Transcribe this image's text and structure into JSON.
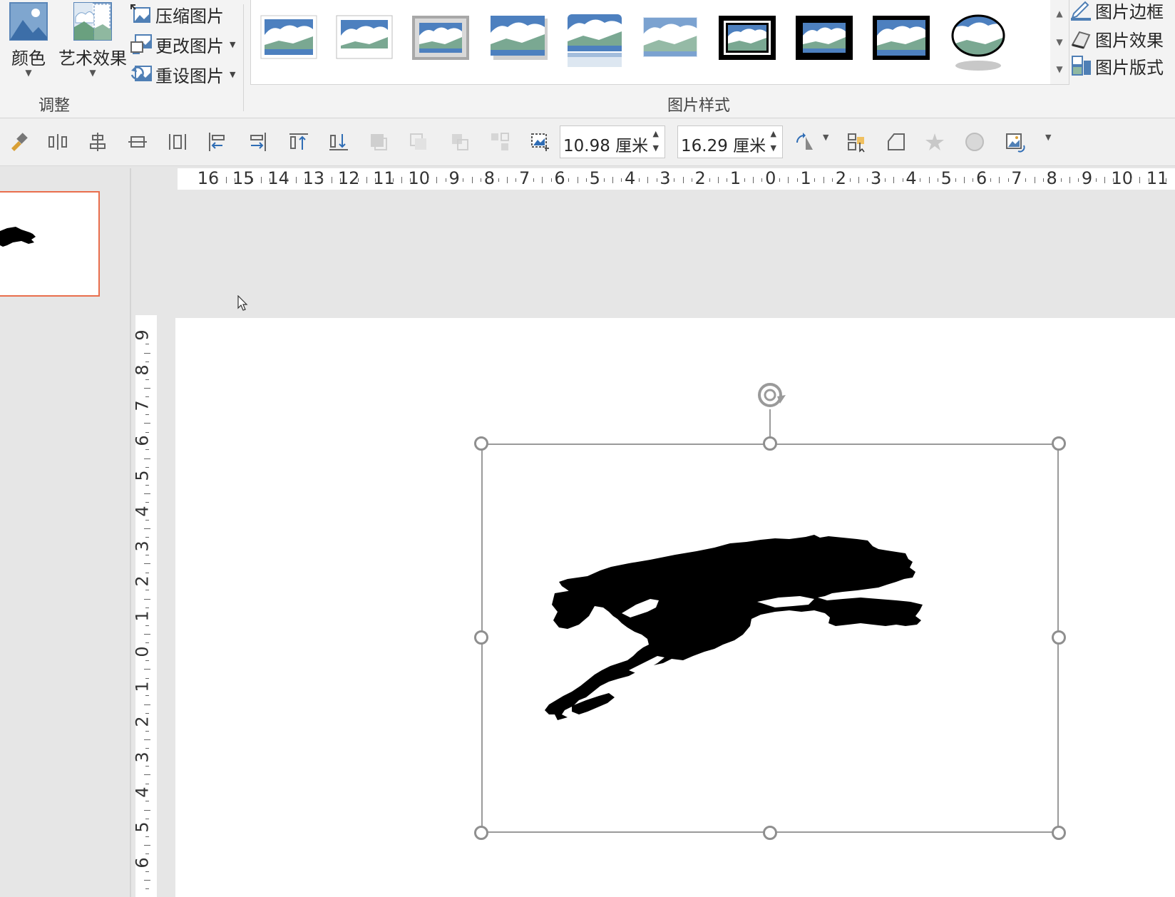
{
  "ribbon": {
    "adjust": {
      "color_label": "颜色",
      "artistic_label": "艺术效果",
      "compress_label": "压缩图片",
      "change_label": "更改图片",
      "reset_label": "重设图片",
      "group_label": "调整"
    },
    "styles_group_label": "图片样式",
    "right": {
      "border_label": "图片边框",
      "effects_label": "图片效果",
      "layout_label": "图片版式"
    }
  },
  "qat": {
    "height_value": "10.98 厘米",
    "width_value": "16.29 厘米"
  },
  "rulers": {
    "horizontal": [
      "16",
      "15",
      "14",
      "13",
      "12",
      "11",
      "10",
      "9",
      "8",
      "7",
      "6",
      "5",
      "4",
      "3",
      "2",
      "1",
      "0",
      "1",
      "2",
      "3",
      "4",
      "5",
      "6",
      "7",
      "8",
      "9",
      "10",
      "11"
    ],
    "vertical": [
      "9",
      "8",
      "7",
      "6",
      "5",
      "4",
      "3",
      "2",
      "1",
      "0",
      "1",
      "2",
      "3",
      "4",
      "5",
      "6"
    ]
  },
  "colors": {
    "thumbnail_border": "#e96e4c",
    "ribbon_bg": "#f3f3f3",
    "workspace_bg": "#e6e6e6"
  }
}
